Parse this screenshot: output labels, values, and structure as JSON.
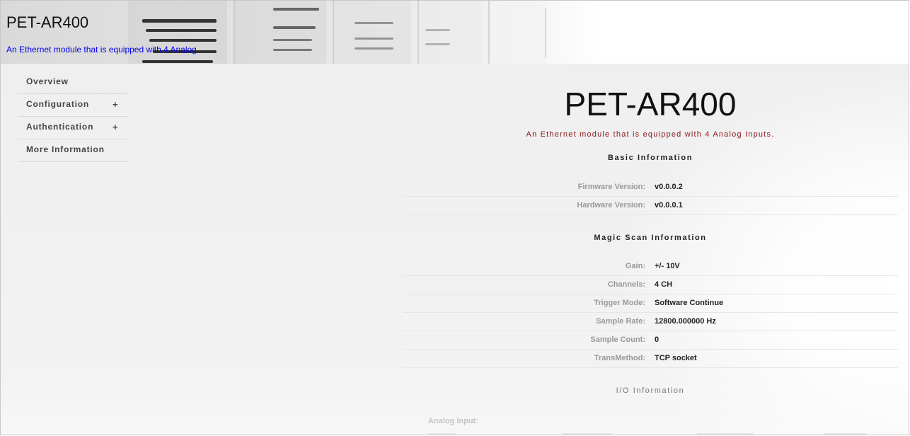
{
  "header": {
    "title": "PET-AR400",
    "subtitle": "An Ethernet module that is equipped with 4 Analog"
  },
  "sidebar": {
    "items": [
      {
        "label": "Overview",
        "expand": ""
      },
      {
        "label": "Configuration",
        "expand": "+"
      },
      {
        "label": "Authentication",
        "expand": "+"
      },
      {
        "label": "More Information",
        "expand": ""
      }
    ]
  },
  "main": {
    "title": "PET-AR400",
    "tagline": "An Ethernet module that is equipped with 4 Analog Inputs.",
    "basic": {
      "heading": "Basic Information",
      "rows": [
        {
          "label": "Firmware Version:",
          "value": "v0.0.0.2"
        },
        {
          "label": "Hardware Version:",
          "value": "v0.0.0.1"
        }
      ]
    },
    "magic": {
      "heading": "Magic Scan Information",
      "rows": [
        {
          "label": "Gain:",
          "value": "+/- 10V"
        },
        {
          "label": "Channels:",
          "value": "4 CH"
        },
        {
          "label": "Trigger Mode:",
          "value": "Software Continue"
        },
        {
          "label": "Sample Rate:",
          "value": "12800.000000 Hz"
        },
        {
          "label": "Sample Count:",
          "value": "0"
        },
        {
          "label": "TransMethod:",
          "value": "TCP socket"
        }
      ]
    },
    "io": {
      "heading": "I/O Information",
      "analog_label": "Analog Input:"
    }
  }
}
